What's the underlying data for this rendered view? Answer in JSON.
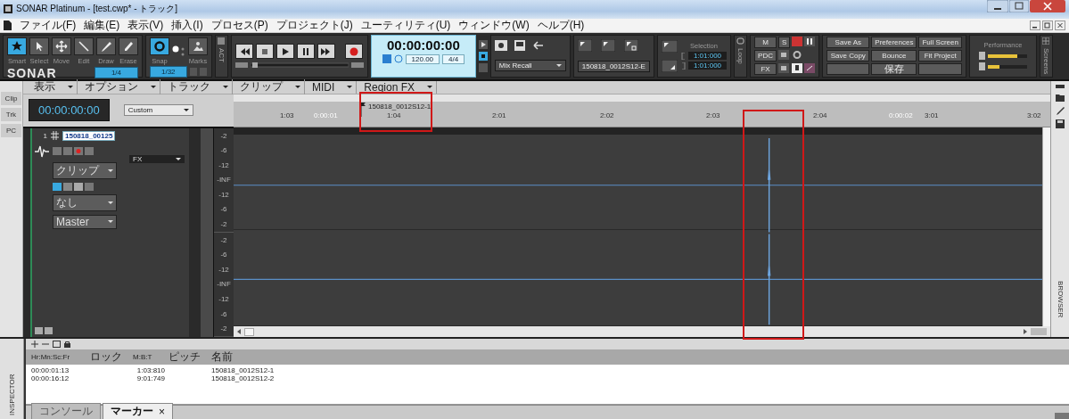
{
  "window": {
    "title": "SONAR Platinum - [test.cwp* - トラック]"
  },
  "menu": [
    "ファイル(F)",
    "編集(E)",
    "表示(V)",
    "挿入(I)",
    "プロセス(P)",
    "プロジェクト(J)",
    "ユーティリティ(U)",
    "ウィンドウ(W)",
    "ヘルプ(H)"
  ],
  "toolbar": {
    "tools": [
      {
        "label": "Smart",
        "selected": true
      },
      {
        "label": "Select",
        "selected": false
      },
      {
        "label": "Move",
        "selected": false
      },
      {
        "label": "Edit",
        "selected": false
      },
      {
        "label": "Draw",
        "selected": false
      },
      {
        "label": "Erase",
        "selected": false
      }
    ],
    "logo": "SONAR",
    "tool_snap": "1/4",
    "snap": {
      "label": "Snap",
      "on": true,
      "value": "1/32"
    },
    "marks": "Marks",
    "act": "ACT",
    "time": "00:00:00:00",
    "tempo": "120.00",
    "meter": "4/4",
    "mix_recall": "Mix Recall",
    "project_name": "150818_0012S12-E",
    "selection": {
      "title": "Selection",
      "start": "1:01:000",
      "end": "1:01:000"
    },
    "loop": "Loop",
    "mix_buttons": [
      "M",
      "S",
      "PDC",
      "FX"
    ],
    "file_buttons": [
      "Save As",
      "Preferences",
      "Full Screen",
      "Save Copy",
      "Bounce",
      "Fit Project",
      "保存"
    ],
    "performance": {
      "title": "Performance",
      "meters": [
        {
          "level": 0.75
        },
        {
          "level": 0.3
        }
      ]
    },
    "screens": "Screens"
  },
  "track_view": {
    "left_tabs": [
      "Clip",
      "Trk",
      "PC"
    ],
    "menus": [
      "表示",
      "オプション",
      "トラック",
      "クリップ",
      "MIDI",
      "Region FX"
    ],
    "time": "00:00:00:00",
    "zoom_preset": "Custom",
    "ruler": [
      {
        "label": "1:03",
        "kind": "beat"
      },
      {
        "label": "0:00:01",
        "kind": "time"
      },
      {
        "label": "1:04",
        "kind": "beat"
      },
      {
        "label": "2:01",
        "kind": "beat"
      },
      {
        "label": "2:02",
        "kind": "beat"
      },
      {
        "label": "2:03",
        "kind": "beat"
      },
      {
        "label": "2:04",
        "kind": "beat"
      },
      {
        "label": "0:00:02",
        "kind": "time"
      },
      {
        "label": "3:01",
        "kind": "beat"
      },
      {
        "label": "3:02",
        "kind": "beat"
      }
    ],
    "marker": "150818_0012S12-1",
    "track": {
      "number": "1",
      "name": "150818_00125",
      "fx": "FX",
      "dropdowns": [
        "クリップ",
        "なし",
        "Master"
      ]
    },
    "lanes": [
      {
        "scale": [
          "-2",
          "-6",
          "-12",
          "-INF",
          "-12",
          "-6",
          "-2"
        ]
      },
      {
        "scale": [
          "-2",
          "-6",
          "-12",
          "-INF",
          "-12",
          "-6",
          "-2"
        ]
      }
    ],
    "browser": "BROWSER"
  },
  "markers_pane": {
    "inspector": "INSPECTOR",
    "columns": [
      "Hr:Mn:Sc:Fr",
      "ロック",
      "M:B:T",
      "ピッチ",
      "名前"
    ],
    "rows": [
      {
        "time": "00:00:01:13",
        "mbt": "1:03:810",
        "name": "150818_0012S12-1"
      },
      {
        "time": "00:00:16:12",
        "mbt": "9:01:749",
        "name": "150818_0012S12-2"
      }
    ],
    "tabs": [
      {
        "label": "コンソール",
        "selected": false
      },
      {
        "label": "マーカー",
        "selected": true,
        "close": "×"
      }
    ]
  }
}
